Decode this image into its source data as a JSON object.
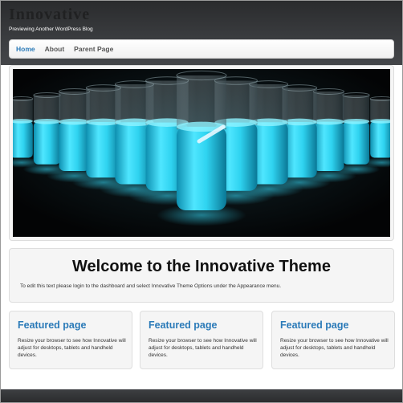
{
  "site": {
    "title": "Innovative",
    "tagline": "Previewing Another WordPress Blog"
  },
  "nav": {
    "items": [
      {
        "label": "Home",
        "active": true
      },
      {
        "label": "About",
        "active": false
      },
      {
        "label": "Parent Page",
        "active": false
      }
    ]
  },
  "slider": {
    "image_description": "rows of glowing cyan test tubes"
  },
  "welcome": {
    "title": "Welcome to the Innovative Theme",
    "text": "To edit this text please login to the dashboard and select Innovative Theme Options under the Appearance menu."
  },
  "features": [
    {
      "title": "Featured page",
      "text": "Resize your browser to see how Innovative will adjust for desktops, tablets and handheld devices."
    },
    {
      "title": "Featured page",
      "text": "Resize your browser to see how Innovative will adjust for desktops, tablets and handheld devices."
    },
    {
      "title": "Featured page",
      "text": "Resize your browser to see how Innovative will adjust for desktops, tablets and handheld devices."
    }
  ],
  "colors": {
    "accent": "#2a7ab8",
    "header_dark": "#2a2b2d",
    "glow": "#2fd3f0"
  }
}
